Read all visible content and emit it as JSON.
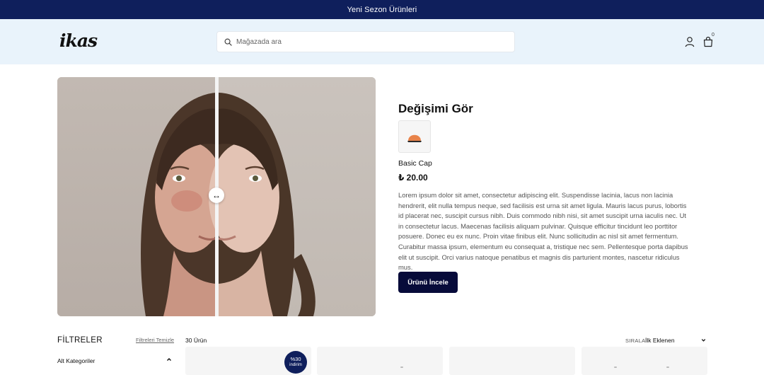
{
  "announcement": {
    "text": "Yeni Sezon Ürünleri"
  },
  "header": {
    "logo_text": "ikas",
    "search": {
      "placeholder": "Mağazada ara",
      "value": ""
    },
    "icons": [
      "search-icon",
      "user-icon",
      "shopping-bag-icon"
    ],
    "cart_count": "0"
  },
  "hero": {
    "compare_slider": {
      "handle_glyph": "↔",
      "handle_icon": "left-right-arrows-icon",
      "position": 0.5
    },
    "title": "Değişimi Gör",
    "product": {
      "name": "Basic Cap",
      "price": "₺ 20.00",
      "thumbnail_icon": "cap-icon"
    },
    "description": "Lorem ipsum dolor sit amet, consectetur adipiscing elit. Suspendisse lacinia, lacus non lacinia hendrerit, elit nulla tempus neque, sed facilisis est urna sit amet ligula. Mauris lacus purus, lobortis id placerat nec, suscipit cursus nibh. Duis commodo nibh nisi, sit amet suscipit urna iaculis nec. Ut in consectetur lacus. Maecenas facilisis aliquam pulvinar. Quisque efficitur tincidunt leo porttitor posuere. Donec eu ex nunc. Proin vitae finibus elit. Nunc sollicitudin ac nisl sit amet fermentum. Curabitur massa ipsum, elementum eu consequat a, tristique nec sem. Pellentesque porta dapibus elit ut suscipit. Orci varius natoque penatibus et magnis dis parturient montes, nascetur ridiculus mus.",
    "cta_label": "Ürünü İncele"
  },
  "listing": {
    "filters_title": "FİLTRELER",
    "clear_filters": "Filtreleri Temizle",
    "subcategories_label": "Alt Kategoriler",
    "product_count": "30 Ürün",
    "sort_label": "SIRALA",
    "sort_value": "İlk Eklenen",
    "discount_badge": {
      "percent": "%30",
      "text": "indirim"
    }
  },
  "colors": {
    "announcement_bg": "#0f1f5c",
    "header_bg": "#e9f3fb",
    "cta_bg": "#070b3a",
    "badge_bg": "#0f1f5c",
    "cap_color": "#e8834a"
  }
}
